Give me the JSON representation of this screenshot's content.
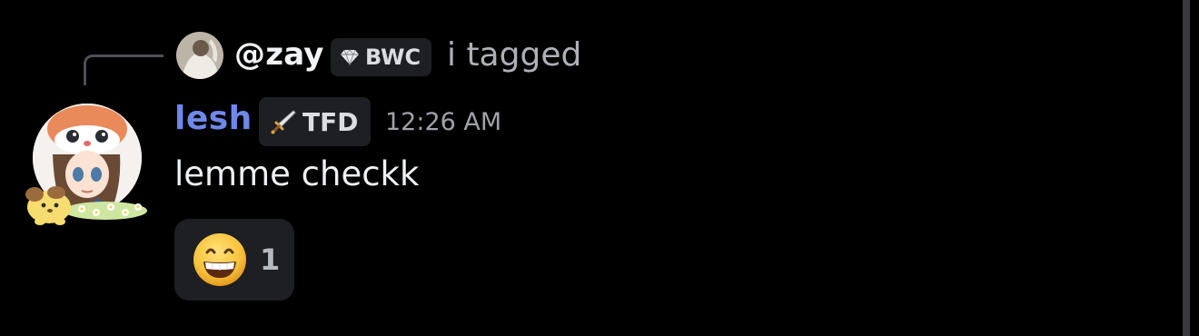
{
  "reply": {
    "username": "@zay",
    "tag": {
      "icon": "diamond-icon",
      "label": "BWC"
    },
    "preview_text": "i tagged"
  },
  "message": {
    "author": "lesh",
    "tag": {
      "icon": "sword-icon",
      "label": "TFD"
    },
    "timestamp": "12:26 AM",
    "text": "lemme checkk",
    "reaction": {
      "emoji": "grinning-face-icon",
      "count": "1"
    }
  },
  "colors": {
    "background": "#000000",
    "author": "#6f88e8",
    "tag_bg": "#1e1f22",
    "muted_text": "#aeb0b6"
  }
}
